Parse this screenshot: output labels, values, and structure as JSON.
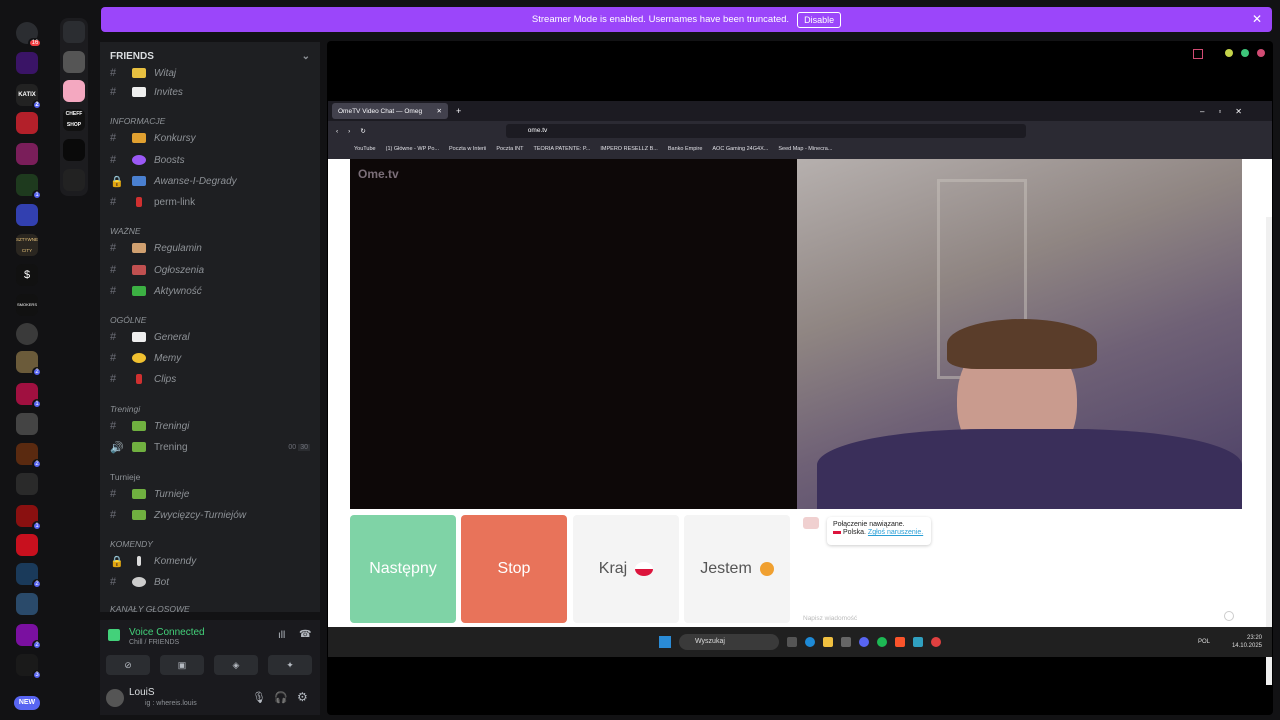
{
  "banner": {
    "text": "Streamer Mode is enabled. Usernames have been truncated.",
    "button": "Disable"
  },
  "rail": {
    "badge_top": "16",
    "new_label": "NEW",
    "server_names": [
      "KATIX",
      "CHEFF SHOP",
      "SZTYWNE CITY",
      "SMOKERS"
    ],
    "badges": [
      "2",
      "1",
      "2",
      "1",
      "2",
      "1",
      "2",
      "2",
      "3"
    ]
  },
  "channels": {
    "header": "FRIENDS",
    "categories": [
      "INFORMACJE",
      "WAŻNE",
      "OGÓLNE",
      "Treningi",
      "Turnieje",
      "KOMENDY",
      "KANAŁY GŁOSOWE"
    ],
    "items": [
      "Witaj",
      "Invites",
      "Konkursy",
      "Boosts",
      "Awanse-I-Degrady",
      "perm-link",
      "Regulamin",
      "Ogłoszenia",
      "Aktywność",
      "General",
      "Memy",
      "Clips",
      "Treningi",
      "Trening",
      "Turnieje",
      "Zwycięzcy-Turniejów",
      "Komendy",
      "Bot"
    ],
    "trening_count": "00",
    "trening_limit": "30"
  },
  "voice": {
    "title": "Voice Connected",
    "subtitle": "Chill / FRIENDS",
    "username": "LouiS",
    "user_sub": "ig : whereis.louis"
  },
  "browser": {
    "tab_title": "OmeTV Video Chat — Omeg",
    "url": "ome.tv",
    "bookmarks": [
      "YouTube",
      "(1) Główne - WP Po...",
      "Poczta w Interii",
      "Poczta INT",
      "TEORIA PATENTE: P...",
      "IMPERO RESELLZ B...",
      "Banko Empire",
      "AOC Gaming 24G4X...",
      "Seed Map - Minecra..."
    ]
  },
  "page": {
    "logo": "Ome.tv",
    "buttons": {
      "next": "Następny",
      "stop": "Stop",
      "country": "Kraj",
      "gender": "Jestem"
    },
    "chat_line1": "Połączenie nawiązane.",
    "chat_line2": "Polska.",
    "chat_link": "Zgłoś naruszenie.",
    "chat_placeholder": "Napisz wiadomość"
  },
  "taskbar": {
    "search": "Wyszukaj",
    "lang": "POL",
    "time": "23:20",
    "date": "14.10.2025"
  },
  "colors": {
    "banner": "#9b46fa",
    "next": "#7fd3a6",
    "stop": "#e8735a",
    "voice_green": "#43d17a"
  }
}
